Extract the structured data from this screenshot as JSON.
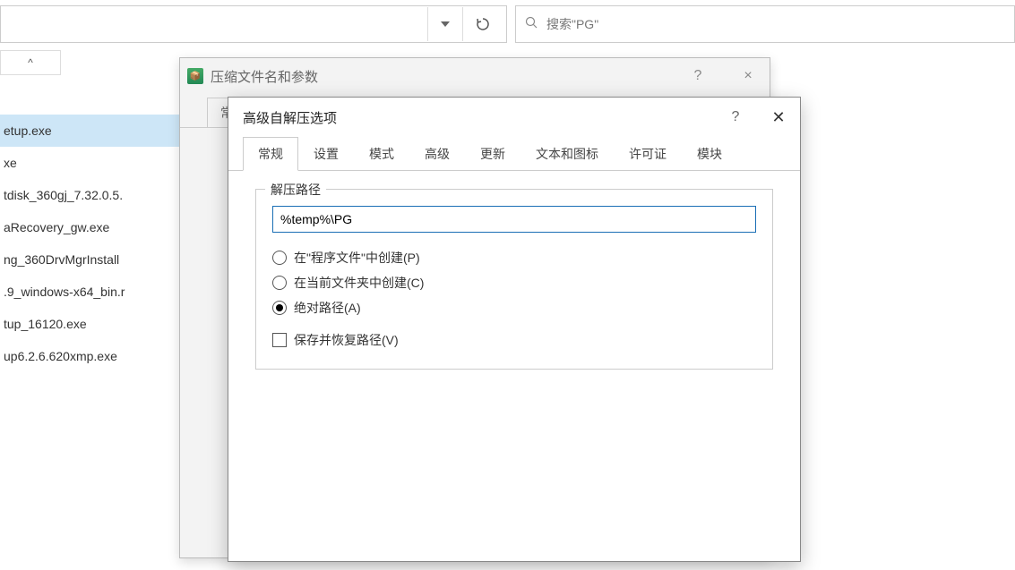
{
  "explorer": {
    "search_placeholder": "搜索\"PG\"",
    "sort_caret": "^",
    "files": [
      "etup.exe",
      "xe",
      "tdisk_360gj_7.32.0.5.",
      "aRecovery_gw.exe",
      "ng_360DrvMgrInstall",
      ".9_windows-x64_bin.r",
      "tup_16120.exe",
      "up6.2.6.620xmp.exe"
    ],
    "selected_index": 0
  },
  "dialog1": {
    "title": "压缩文件名和参数",
    "tab_label": "常规",
    "help": "?",
    "close": "×"
  },
  "dialog2": {
    "title": "高级自解压选项",
    "help": "?",
    "close": "✕",
    "tabs": [
      "常规",
      "设置",
      "模式",
      "高级",
      "更新",
      "文本和图标",
      "许可证",
      "模块"
    ],
    "active_tab": 0,
    "fieldset_legend": "解压路径",
    "path_value": "%temp%\\PG",
    "radios": [
      {
        "label": "在\"程序文件\"中创建(P)",
        "selected": false
      },
      {
        "label": "在当前文件夹中创建(C)",
        "selected": false
      },
      {
        "label": "绝对路径(A)",
        "selected": true
      }
    ],
    "checkbox": {
      "label": "保存并恢复路径(V)",
      "checked": false
    }
  }
}
